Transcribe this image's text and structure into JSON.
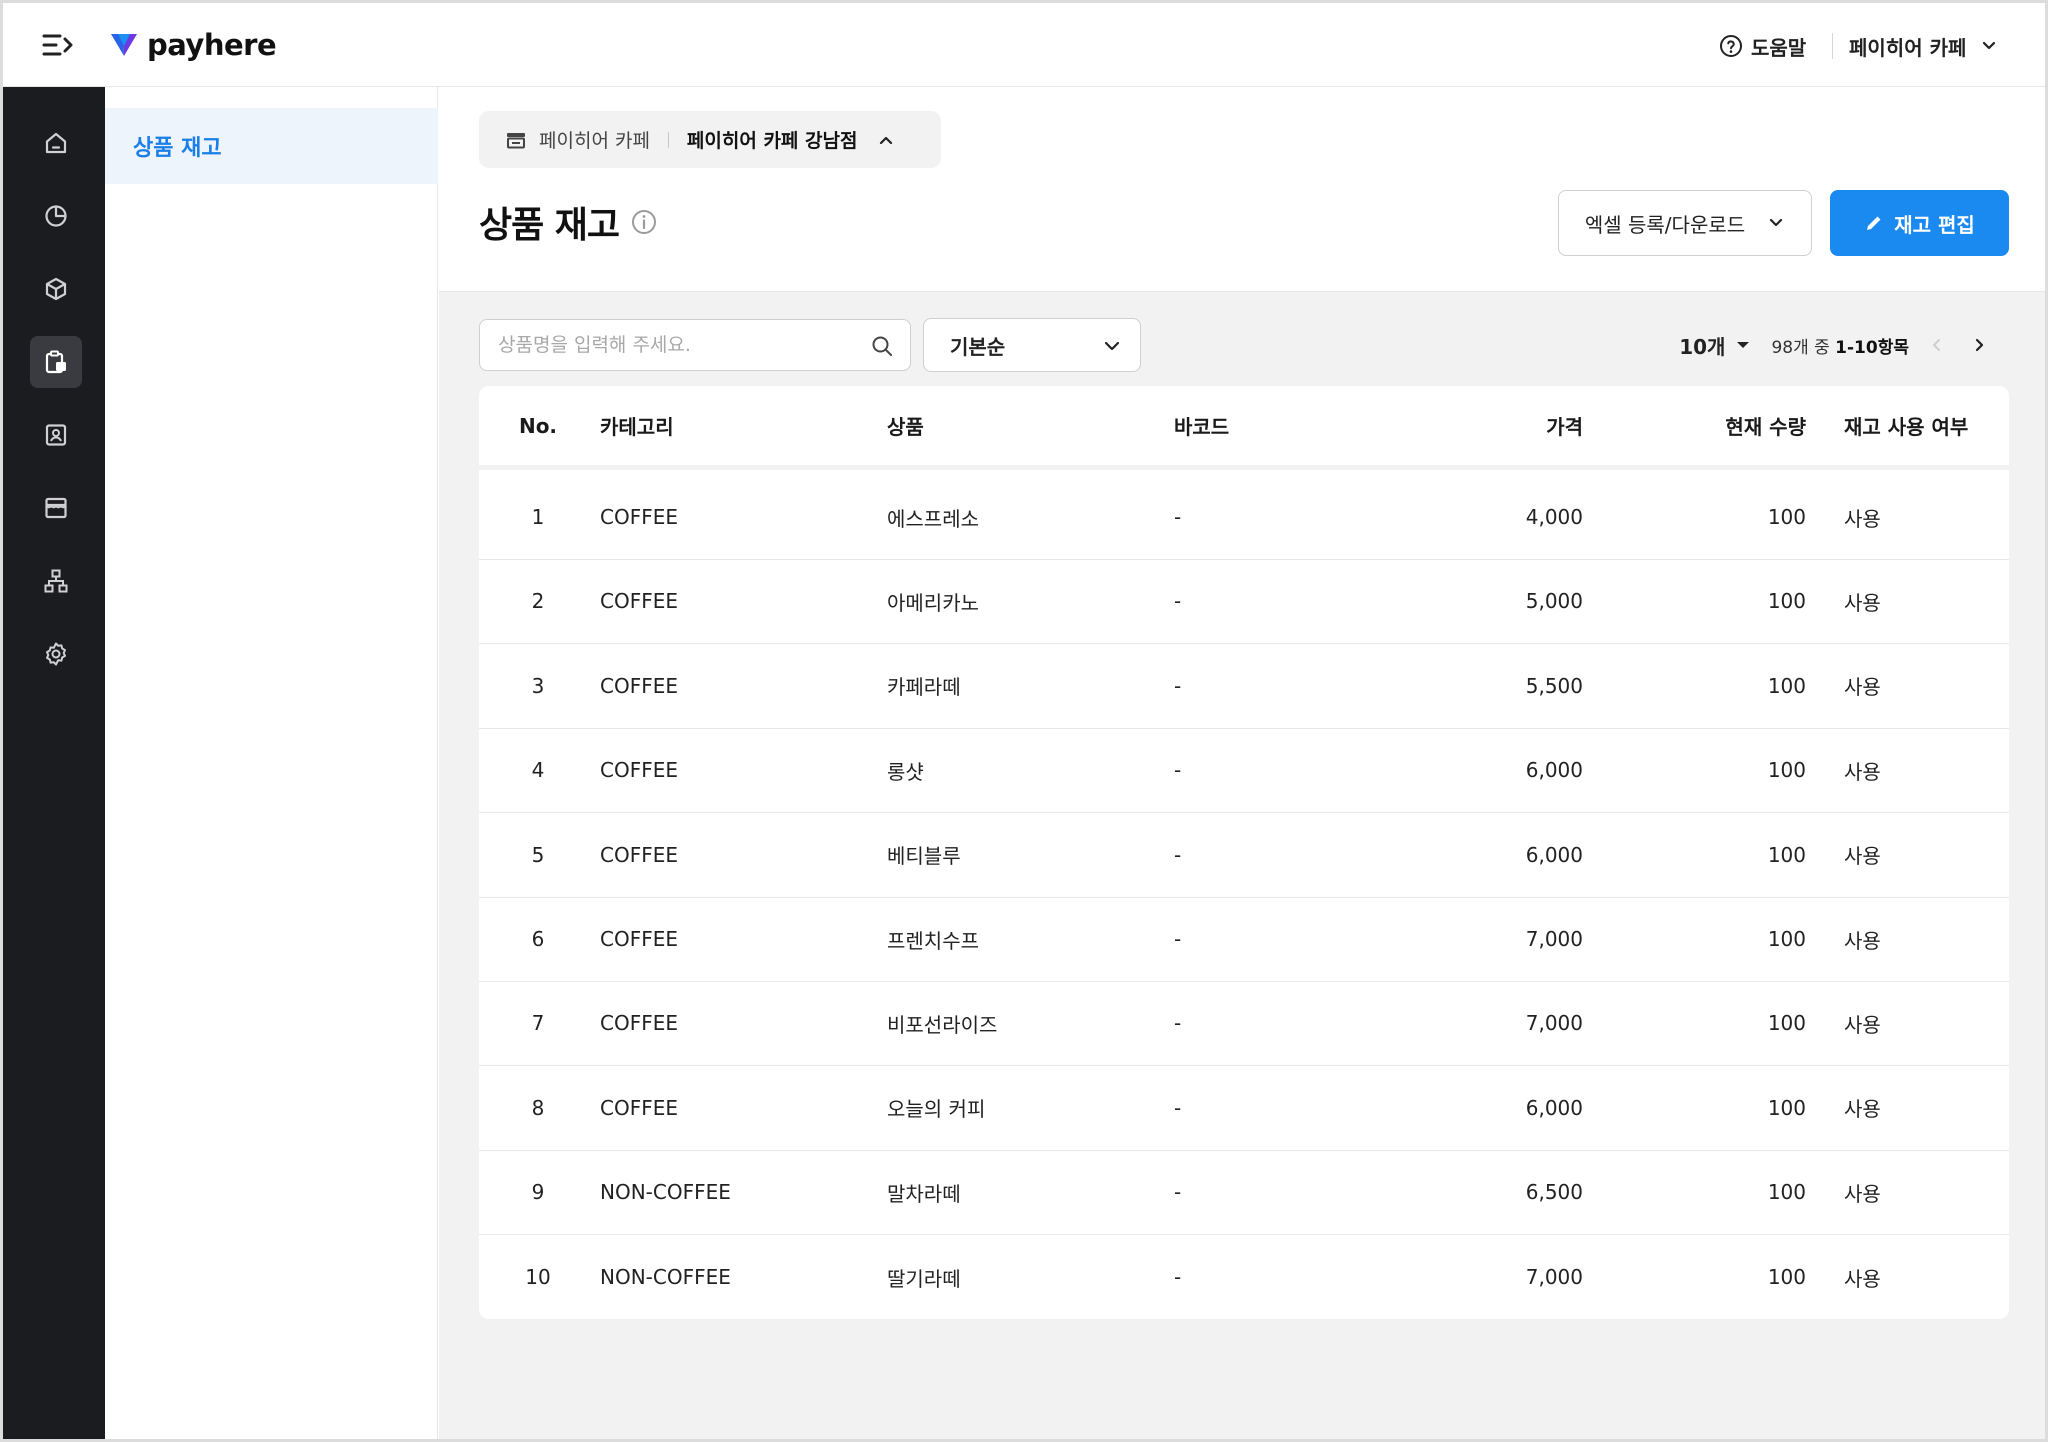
{
  "header": {
    "logo_text": "payhere",
    "help_label": "도움말",
    "account_label": "페이히어 카페"
  },
  "rail": {
    "items": [
      {
        "icon": "home-icon"
      },
      {
        "icon": "pie-chart-icon"
      },
      {
        "icon": "cube-icon"
      },
      {
        "icon": "inventory-icon",
        "active": true
      },
      {
        "icon": "contact-card-icon"
      },
      {
        "icon": "store-icon"
      },
      {
        "icon": "org-chart-icon"
      },
      {
        "icon": "gear-icon"
      }
    ]
  },
  "subnav": {
    "items": [
      {
        "label": "상품 재고",
        "active": true
      }
    ]
  },
  "store_select": {
    "brand": "페이히어 카페",
    "branch": "페이히어 카페 강남점"
  },
  "page": {
    "title": "상품 재고",
    "excel_button": "엑셀 등록/다운로드",
    "edit_button": "재고 편집"
  },
  "filters": {
    "search_placeholder": "상품명을 입력해 주세요.",
    "sort_value": "기본순"
  },
  "pagination": {
    "per_page": "10개",
    "range_prefix": "98개 중 ",
    "range_bold": "1-10항목"
  },
  "table": {
    "columns": {
      "no": "No.",
      "category": "카테고리",
      "product": "상품",
      "barcode": "바코드",
      "price": "가격",
      "qty": "현재 수량",
      "use": "재고 사용 여부"
    },
    "rows": [
      {
        "no": "1",
        "category": "COFFEE",
        "product": "에스프레소",
        "barcode": "-",
        "price": "4,000",
        "qty": "100",
        "use": "사용"
      },
      {
        "no": "2",
        "category": "COFFEE",
        "product": "아메리카노",
        "barcode": "-",
        "price": "5,000",
        "qty": "100",
        "use": "사용"
      },
      {
        "no": "3",
        "category": "COFFEE",
        "product": "카페라떼",
        "barcode": "-",
        "price": "5,500",
        "qty": "100",
        "use": "사용"
      },
      {
        "no": "4",
        "category": "COFFEE",
        "product": "롱샷",
        "barcode": "-",
        "price": "6,000",
        "qty": "100",
        "use": "사용"
      },
      {
        "no": "5",
        "category": "COFFEE",
        "product": "베티블루",
        "barcode": "-",
        "price": "6,000",
        "qty": "100",
        "use": "사용"
      },
      {
        "no": "6",
        "category": "COFFEE",
        "product": "프렌치수프",
        "barcode": "-",
        "price": "7,000",
        "qty": "100",
        "use": "사용"
      },
      {
        "no": "7",
        "category": "COFFEE",
        "product": "비포선라이즈",
        "barcode": "-",
        "price": "7,000",
        "qty": "100",
        "use": "사용"
      },
      {
        "no": "8",
        "category": "COFFEE",
        "product": "오늘의 커피",
        "barcode": "-",
        "price": "6,000",
        "qty": "100",
        "use": "사용"
      },
      {
        "no": "9",
        "category": "NON-COFFEE",
        "product": "말차라떼",
        "barcode": "-",
        "price": "6,500",
        "qty": "100",
        "use": "사용"
      },
      {
        "no": "10",
        "category": "NON-COFFEE",
        "product": "딸기라떼",
        "barcode": "-",
        "price": "7,000",
        "qty": "100",
        "use": "사용"
      }
    ]
  },
  "colors": {
    "accent": "#1a89f0",
    "rail_bg": "#1b1c20",
    "subnav_active_bg": "#eef4fb",
    "subnav_active_text": "#1a7fe8",
    "content_bg": "#f2f2f3"
  }
}
